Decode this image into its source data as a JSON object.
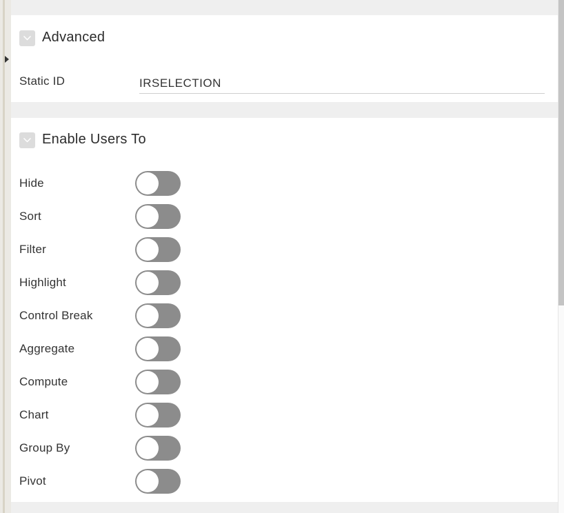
{
  "advanced": {
    "title": "Advanced",
    "static_id_label": "Static ID",
    "static_id_value": "IRSELECTION"
  },
  "enable_users": {
    "title": "Enable Users To",
    "options": [
      {
        "label": "Hide",
        "enabled": false
      },
      {
        "label": "Sort",
        "enabled": false
      },
      {
        "label": "Filter",
        "enabled": false
      },
      {
        "label": "Highlight",
        "enabled": false
      },
      {
        "label": "Control Break",
        "enabled": false
      },
      {
        "label": "Aggregate",
        "enabled": false
      },
      {
        "label": "Compute",
        "enabled": false
      },
      {
        "label": "Chart",
        "enabled": false
      },
      {
        "label": "Group By",
        "enabled": false
      },
      {
        "label": "Pivot",
        "enabled": false
      }
    ]
  }
}
